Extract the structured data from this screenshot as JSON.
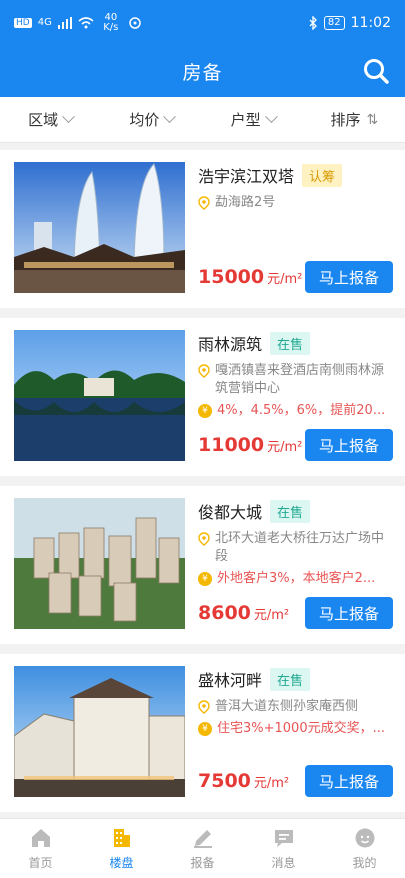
{
  "status_bar": {
    "left_icons": [
      "HD",
      "4G"
    ],
    "speed": "40 K/s",
    "battery": "82",
    "time": "11:02"
  },
  "header": {
    "title": "房备"
  },
  "filters": [
    {
      "label": "区域"
    },
    {
      "label": "均价"
    },
    {
      "label": "户型"
    },
    {
      "label": "排序"
    }
  ],
  "listings": [
    {
      "name": "浩宇滨江双塔",
      "tag": "认筹",
      "address": "勐海路2号",
      "promo": "",
      "price": "15000",
      "unit": "元/m²",
      "button": "马上报备"
    },
    {
      "name": "雨林源筑",
      "tag": "在售",
      "address": "嘎洒镇喜来登酒店南侧雨林源筑营销中心",
      "promo": "4%，4.5%，6%，提前20...",
      "price": "11000",
      "unit": "元/m²",
      "button": "马上报备"
    },
    {
      "name": "俊都大城",
      "tag": "在售",
      "address": "北环大道老大桥往万达广场中段",
      "promo": "外地客户3%，本地客户2...",
      "price": "8600",
      "unit": "元/m²",
      "button": "马上报备"
    },
    {
      "name": "盛林河畔",
      "tag": "在售",
      "address": "普洱大道东侧孙家庵西侧",
      "promo": "住宅3%+1000元成交奖，...",
      "price": "7500",
      "unit": "元/m²",
      "button": "马上报备"
    }
  ],
  "tabbar": [
    {
      "label": "首页",
      "icon": "home-icon"
    },
    {
      "label": "楼盘",
      "icon": "building-icon",
      "active": true
    },
    {
      "label": "报备",
      "icon": "pen-icon"
    },
    {
      "label": "消息",
      "icon": "message-icon"
    },
    {
      "label": "我的",
      "icon": "profile-icon"
    }
  ],
  "colors": {
    "primary": "#1a86f0",
    "price": "#e53935",
    "tag_renchou": "#d89a00",
    "tag_zaishou": "#20a990"
  }
}
